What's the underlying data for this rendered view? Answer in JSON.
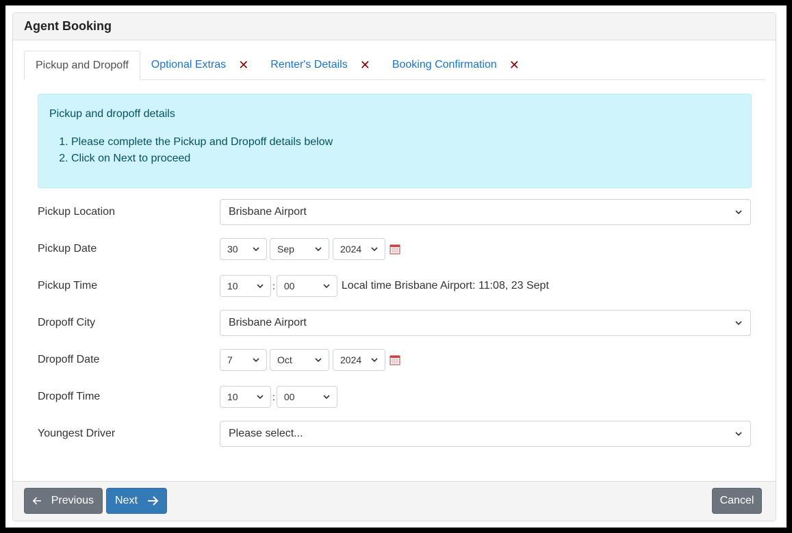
{
  "header": {
    "title": "Agent Booking"
  },
  "tabs": [
    {
      "label": "Pickup and Dropoff",
      "active": true
    },
    {
      "label": "Optional Extras",
      "close": "✕"
    },
    {
      "label": "Renter's Details",
      "close": "✕"
    },
    {
      "label": "Booking Confirmation",
      "close": "✕"
    }
  ],
  "info": {
    "title": "Pickup and dropoff details",
    "steps": [
      "Please complete the Pickup and Dropoff details below",
      "Click on Next to proceed"
    ]
  },
  "form": {
    "pickup_location": {
      "label": "Pickup Location",
      "value": "Brisbane Airport"
    },
    "pickup_date": {
      "label": "Pickup Date",
      "day": "30",
      "month": "Sep",
      "year": "2024"
    },
    "pickup_time": {
      "label": "Pickup Time",
      "hour": "10",
      "separator": ":",
      "minute": "00",
      "local_time": "Local time Brisbane Airport: 11:08, 23 Sept"
    },
    "dropoff_city": {
      "label": "Dropoff City",
      "value": "Brisbane Airport"
    },
    "dropoff_date": {
      "label": "Dropoff Date",
      "day": "7",
      "month": "Oct",
      "year": "2024"
    },
    "dropoff_time": {
      "label": "Dropoff Time",
      "hour": "10",
      "separator": ":",
      "minute": "00"
    },
    "youngest_driver": {
      "label": "Youngest Driver",
      "value": "Please select..."
    }
  },
  "footer": {
    "previous": "Previous",
    "next": "Next",
    "cancel": "Cancel"
  },
  "icons": {
    "chevron": "chevron-down-icon",
    "calendar": "calendar-icon",
    "arrow_left": "arrow-left-icon",
    "arrow_right": "arrow-right-icon"
  },
  "colors": {
    "link": "#1a73c8",
    "close": "#8b0000",
    "info_bg": "#cff4fc",
    "info_text": "#055160",
    "next_btn": "#337ab7",
    "secondary_btn": "#6c757d"
  }
}
